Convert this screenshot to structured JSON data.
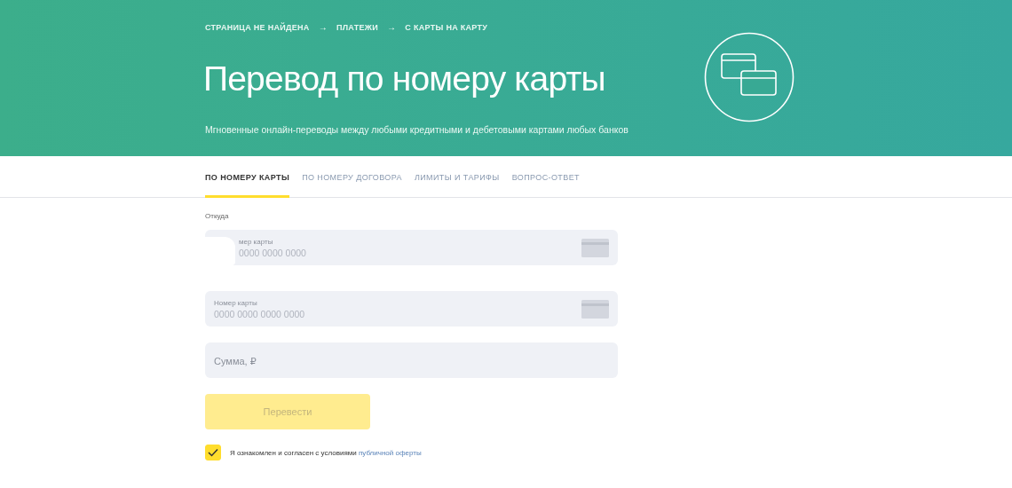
{
  "breadcrumbs": [
    {
      "label": "СТРАНИЦА НЕ НАЙДЕНА"
    },
    {
      "label": "ПЛАТЕЖИ"
    },
    {
      "label": "С КАРТЫ НА КАРТУ"
    }
  ],
  "breadcrumb_separator": "→",
  "title": "Перевод по номеру карты",
  "subtitle": "Мгновенные онлайн-переводы между любыми кредитными и дебетовыми картами любых банков",
  "tabs": [
    {
      "label": "ПО НОМЕРУ КАРТЫ",
      "selected": true
    },
    {
      "label": "ПО НОМЕРУ ДОГОВОРА",
      "selected": false
    },
    {
      "label": "ЛИМИТЫ И ТАРИФЫ",
      "selected": false
    },
    {
      "label": "ВОПРОС-ОТВЕТ",
      "selected": false
    }
  ],
  "form": {
    "from_label": "Откуда",
    "fields": [
      {
        "kind": "card",
        "label": "мер карты",
        "placeholder": "0000 0000 0000",
        "covered": true
      },
      {
        "kind": "card",
        "label": "Номер карты",
        "placeholder": "0000 0000 0000 0000",
        "covered": false
      },
      {
        "kind": "amount",
        "placeholder": "Сумма, ₽",
        "covered": false
      }
    ],
    "submit": {
      "label": "Перевести",
      "disabled": true
    },
    "agreement": {
      "checked": true,
      "text": "Я ознакомлен и согласен с условиями",
      "link": "публичной оферты"
    }
  }
}
